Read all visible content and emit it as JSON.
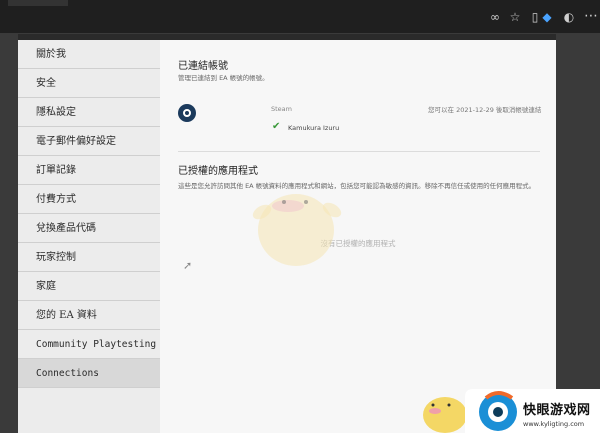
{
  "sidebar": {
    "items": [
      {
        "label": "關於我"
      },
      {
        "label": "安全"
      },
      {
        "label": "隱私設定"
      },
      {
        "label": "電子郵件偏好設定"
      },
      {
        "label": "訂單記錄"
      },
      {
        "label": "付費方式"
      },
      {
        "label": "兌換產品代碼"
      },
      {
        "label": "玩家控制"
      },
      {
        "label": "家庭"
      },
      {
        "label": "您的 EA 資料"
      },
      {
        "label": "Community Playtesting"
      },
      {
        "label": "Connections"
      }
    ]
  },
  "connected": {
    "title": "已連結帳號",
    "description": "管理已連結到 EA 帳號的帳號。",
    "service_name": "Steam",
    "account_name": "Kamukura Izuru",
    "unlink_text": "您可以在 2021-12-29 後取消帳號連結"
  },
  "authorized": {
    "title": "已授權的應用程式",
    "description": "這些是您允許訪問其他 EA 帳號資料的應用程式和網站，包括您可能認為敏感的資訊。移除不再信任或使用的任何應用程式。",
    "empty_message": "沒有已授權的應用程式"
  },
  "watermark": {
    "title": "快眼游戏网",
    "url": "www.kyligting.com"
  },
  "colors": {
    "check_green": "#3a9a3a",
    "steam_navy": "#1b3a5c",
    "sidebar_bg": "#ececec",
    "content_bg": "#f7f7f7"
  }
}
